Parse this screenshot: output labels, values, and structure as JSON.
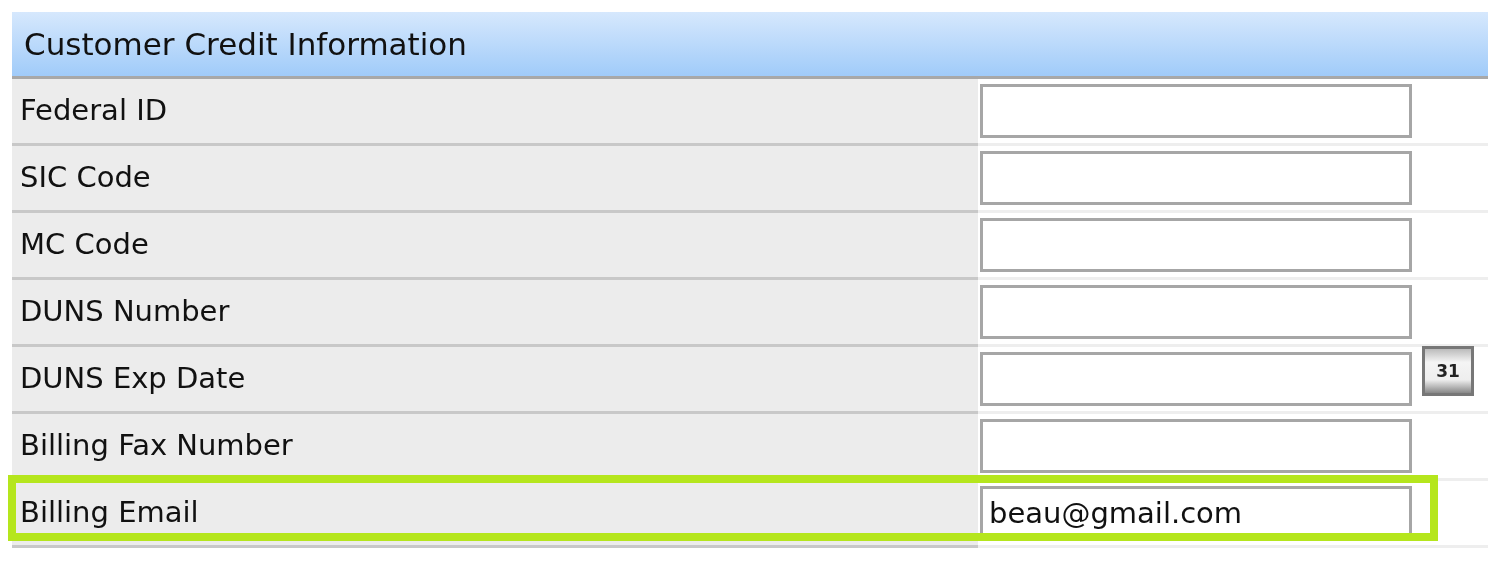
{
  "section": {
    "title": "Customer Credit Information"
  },
  "rows": [
    {
      "label": "Federal ID",
      "kind": "text",
      "highlighted": false
    },
    {
      "label": "SIC Code",
      "kind": "text",
      "highlighted": false
    },
    {
      "label": "MC Code",
      "kind": "text",
      "highlighted": false
    },
    {
      "label": "DUNS Number",
      "kind": "text",
      "highlighted": false
    },
    {
      "label": "DUNS Exp Date",
      "kind": "date",
      "highlighted": false,
      "calendar_icon": "31"
    },
    {
      "label": "Billing Fax Number",
      "kind": "text",
      "highlighted": false
    },
    {
      "label": "Billing Email",
      "kind": "text",
      "highlighted": true,
      "value": "beau@gmail.com"
    }
  ]
}
